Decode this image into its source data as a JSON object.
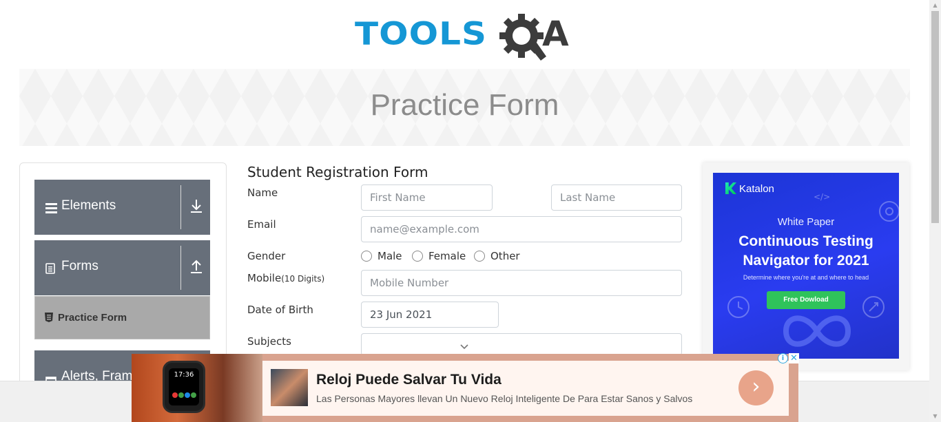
{
  "header": {
    "logo_text": "TOOLS",
    "logo_suffix": "A",
    "banner_title": "Practice Form"
  },
  "sidebar": {
    "groups": [
      {
        "label": "Elements",
        "icon": "hamburger-icon",
        "toggle": "download-arrow-icon"
      },
      {
        "label": "Forms",
        "icon": "document-icon",
        "toggle": "upload-arrow-icon"
      },
      {
        "label": "Alerts, Frame & Windows",
        "icon": "window-icon"
      }
    ],
    "active_item": {
      "label": "Practice Form",
      "icon": "html5-icon"
    }
  },
  "form": {
    "title": "Student Registration Form",
    "name_label": "Name",
    "first_name_placeholder": "First Name",
    "last_name_placeholder": "Last Name",
    "email_label": "Email",
    "email_placeholder": "name@example.com",
    "gender_label": "Gender",
    "gender_options": [
      "Male",
      "Female",
      "Other"
    ],
    "mobile_label": "Mobile",
    "mobile_hint": "(10 Digits)",
    "mobile_placeholder": "Mobile Number",
    "dob_label": "Date of Birth",
    "dob_value": "23 Jun 2021",
    "subjects_label": "Subjects"
  },
  "ad_right": {
    "brand": "Katalon",
    "kicker": "White Paper",
    "headline_line1": "Continuous Testing",
    "headline_line2": "Navigator for 2021",
    "subtext": "Determine where you're at and where to head",
    "button": "Free Dowload",
    "colors": {
      "bg": "#2a3cf0",
      "button": "#2fc35b"
    }
  },
  "ad_bottom": {
    "headline": "Reloj Puede Salvar Tu Vida",
    "description": "Las Personas Mayores llevan Un Nuevo Reloj Inteligente De Para Estar Sanos y Salvos",
    "watch_time": "17:36",
    "info_glyph": "i",
    "close_glyph": "✕",
    "go_glyph": "›"
  },
  "colors": {
    "brand_blue": "#1597d5",
    "sidebar_group": "#676f7a",
    "active_item": "#a9a9a9"
  }
}
